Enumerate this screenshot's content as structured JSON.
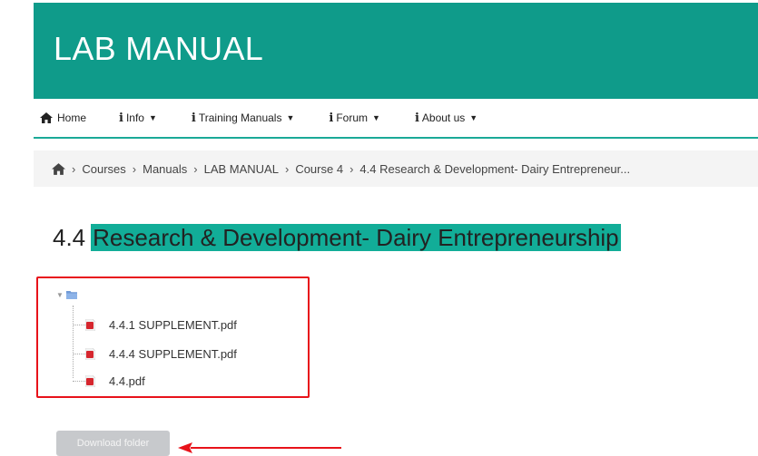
{
  "header": {
    "title": "LAB MANUAL"
  },
  "nav": {
    "home": "Home",
    "info": "Info",
    "training": "Training Manuals",
    "forum": "Forum",
    "about": "About us"
  },
  "breadcrumb": {
    "items": [
      "Courses",
      "Manuals",
      "LAB MANUAL",
      "Course 4",
      "4.4 Research & Development- Dairy Entrepreneur..."
    ]
  },
  "page": {
    "number": "4.4",
    "title": "Research & Development- Dairy Entrepreneurship"
  },
  "files": [
    "4.4.1 SUPPLEMENT.pdf",
    "4.4.4 SUPPLEMENT.pdf",
    "4.4.pdf"
  ],
  "download": {
    "label": "Download folder"
  },
  "colors": {
    "header_bg": "#0f9b8a",
    "title_highlight": "#12ad98",
    "annotation_red": "#e8121a",
    "button_bg": "#c7c9cc"
  },
  "icons": [
    "home-icon",
    "info-icon",
    "caret-down-icon",
    "folder-icon",
    "pdf-icon",
    "tree-toggle-icon"
  ]
}
